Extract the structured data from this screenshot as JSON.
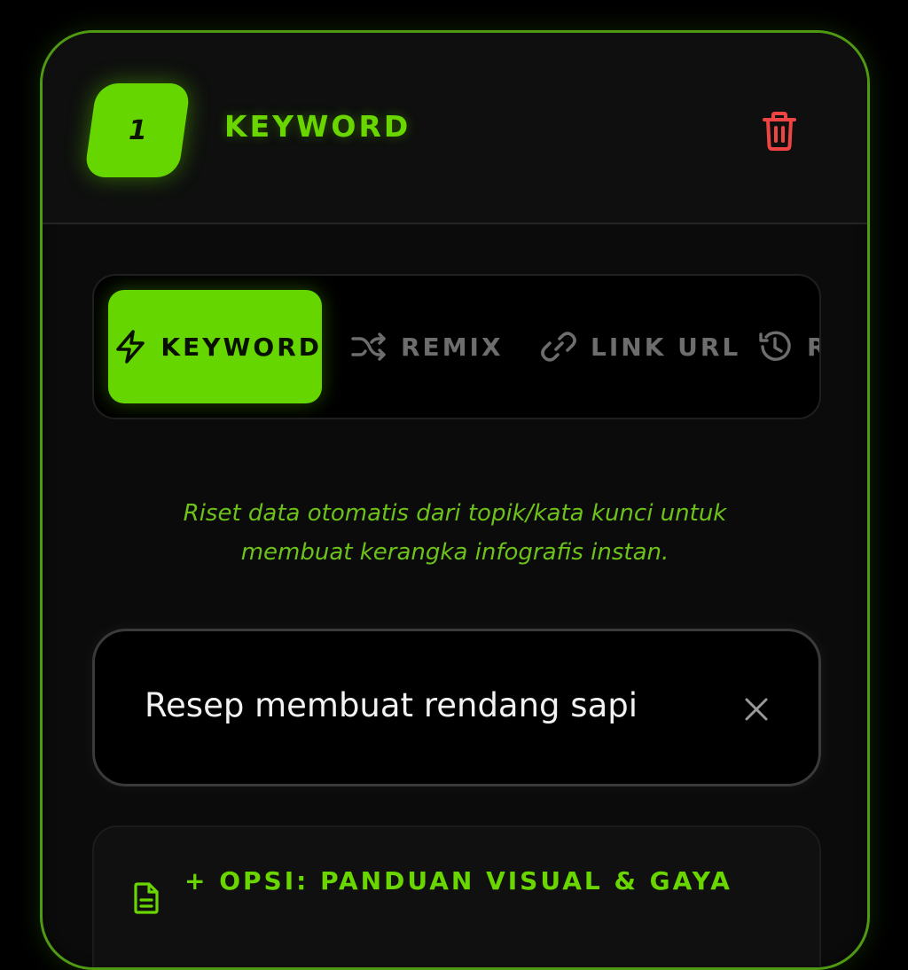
{
  "header": {
    "step_number": "1",
    "title": "KEYWORD",
    "delete_icon": "trash-icon",
    "delete_color": "#ef4444"
  },
  "tabs": [
    {
      "label": "KEYWORD",
      "icon": "lightning-icon",
      "active": true
    },
    {
      "label": "REMIX",
      "icon": "shuffle-icon",
      "active": false
    },
    {
      "label": "LINK URL",
      "icon": "link-icon",
      "active": false
    },
    {
      "label": "R",
      "icon": "history-icon",
      "active": false
    }
  ],
  "description": {
    "line1": "Riset data otomatis dari topik/kata kunci untuk",
    "line2": "membuat kerangka infografis instan."
  },
  "search": {
    "value": "Resep membuat rendang sapi",
    "clear_icon": "close-icon"
  },
  "options": {
    "label": "+ OPSI: PANDUAN VISUAL & GAYA",
    "icon": "document-icon"
  },
  "colors": {
    "accent": "#66d600",
    "background": "#000000",
    "card": "#0b0b0b",
    "danger": "#ef4444"
  }
}
